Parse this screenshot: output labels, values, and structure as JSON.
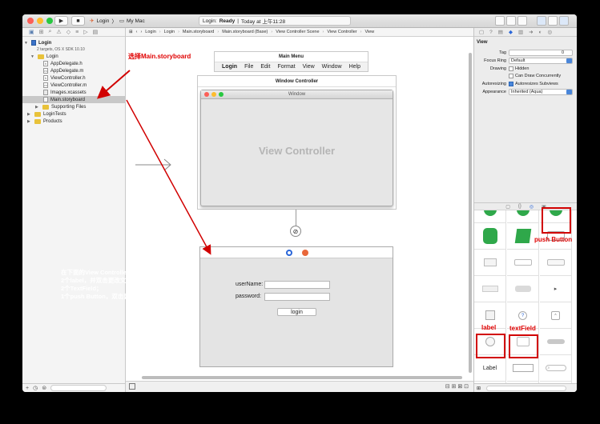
{
  "toolbar": {
    "scheme_target": "Login",
    "scheme_device": "My Mac",
    "status_project": "Login:",
    "status_state": "Ready",
    "status_time": "Today at 上午11:28"
  },
  "navigator": {
    "project_name": "Login",
    "project_sub": "2 targets, OS X SDK 10.10",
    "items": [
      {
        "label": "Login",
        "kind": "folder"
      },
      {
        "label": "AppDelegate.h",
        "kind": "h"
      },
      {
        "label": "AppDelegate.m",
        "kind": "m"
      },
      {
        "label": "ViewController.h",
        "kind": "h"
      },
      {
        "label": "ViewController.m",
        "kind": "m"
      },
      {
        "label": "Images.xcassets",
        "kind": "asset"
      },
      {
        "label": "Main.storyboard",
        "kind": "sb"
      },
      {
        "label": "Supporting Files",
        "kind": "folder"
      },
      {
        "label": "LoginTests",
        "kind": "folder"
      },
      {
        "label": "Products",
        "kind": "folder"
      }
    ]
  },
  "jumpbar": [
    "Login",
    "Login",
    "Main.storyboard",
    "Main.storyboard (Base)",
    "View Controller Scene",
    "View Controller",
    "View"
  ],
  "canvas": {
    "main_menu_title": "Main Menu",
    "menu_items": [
      "Login",
      "File",
      "Edit",
      "Format",
      "View",
      "Window",
      "Help"
    ],
    "window_controller_title": "Window Controller",
    "window_title": "Window",
    "view_controller_placeholder": "View Controller",
    "username_label": "userName:",
    "password_label": "password:",
    "login_button": "login"
  },
  "annotations": {
    "select_storyboard": "选择Main.storyboard",
    "instruction_1": "在下面的View Controller中添加",
    "instruction_2": "2个label，并双击更改文本内容；",
    "instruction_3": "2个TextField；",
    "instruction_4": "1个push Button，双击更改按钮标题",
    "push_button_tag": "push Button",
    "label_tag": "label",
    "textfield_tag": "textField"
  },
  "inspector": {
    "section_title": "View",
    "rows": [
      {
        "label": "Tag",
        "value": "0"
      },
      {
        "label": "Focus Ring",
        "value": "Default"
      },
      {
        "label": "Drawing",
        "value": "Hidden"
      },
      {
        "label": "",
        "value": "Can Draw Concurrently"
      },
      {
        "label": "Autoresizing",
        "value": "Autoresizes Subviews"
      },
      {
        "label": "Appearance",
        "value": "Inherited (Aqua)"
      }
    ]
  },
  "library": {
    "label_sample": "Label",
    "secure_sample": "•••••",
    "number_sample": "1234"
  },
  "colors": {
    "annotation_red": "#d10000",
    "selection_blue": "#4a86d9"
  }
}
